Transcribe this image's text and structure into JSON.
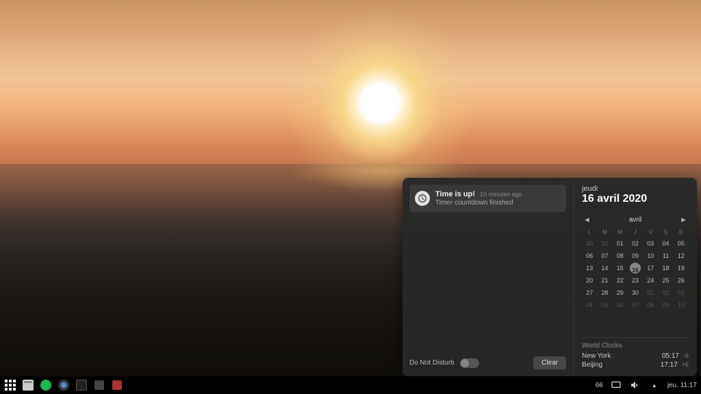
{
  "notification": {
    "title": "Time is up!",
    "time_ago": "10 minutes ago",
    "message": "Timer countdown finished"
  },
  "dnd_label": "Do Not Disturb",
  "clear_label": "Clear",
  "date": {
    "weekday": "jeudi",
    "full": "16 avril 2020"
  },
  "calendar": {
    "month_label": "avril",
    "weekdays": [
      "L",
      "M",
      "M",
      "J",
      "V",
      "S",
      "D"
    ],
    "weeks": [
      [
        {
          "n": "30",
          "o": true
        },
        {
          "n": "31",
          "o": true
        },
        {
          "n": "01"
        },
        {
          "n": "02"
        },
        {
          "n": "03"
        },
        {
          "n": "04"
        },
        {
          "n": "05"
        }
      ],
      [
        {
          "n": "06"
        },
        {
          "n": "07"
        },
        {
          "n": "08"
        },
        {
          "n": "09"
        },
        {
          "n": "10"
        },
        {
          "n": "11"
        },
        {
          "n": "12"
        }
      ],
      [
        {
          "n": "13"
        },
        {
          "n": "14"
        },
        {
          "n": "15"
        },
        {
          "n": "16",
          "today": true
        },
        {
          "n": "17"
        },
        {
          "n": "18"
        },
        {
          "n": "19"
        }
      ],
      [
        {
          "n": "20"
        },
        {
          "n": "21"
        },
        {
          "n": "22"
        },
        {
          "n": "23"
        },
        {
          "n": "24"
        },
        {
          "n": "25"
        },
        {
          "n": "26"
        }
      ],
      [
        {
          "n": "27"
        },
        {
          "n": "28"
        },
        {
          "n": "29"
        },
        {
          "n": "30"
        },
        {
          "n": "01",
          "o": true
        },
        {
          "n": "02",
          "o": true
        },
        {
          "n": "03",
          "o": true
        }
      ],
      [
        {
          "n": "04",
          "o": true
        },
        {
          "n": "05",
          "o": true
        },
        {
          "n": "06",
          "o": true
        },
        {
          "n": "07",
          "o": true
        },
        {
          "n": "08",
          "o": true
        },
        {
          "n": "09",
          "o": true
        },
        {
          "n": "10",
          "o": true
        }
      ]
    ]
  },
  "world_clocks": {
    "title": "World Clocks",
    "rows": [
      {
        "city": "New York",
        "time": "05:17",
        "offset": "-6"
      },
      {
        "city": "Beijing",
        "time": "17:17",
        "offset": "+6"
      }
    ]
  },
  "taskbar": {
    "battery": "66",
    "clock": "jeu. 11:17"
  }
}
